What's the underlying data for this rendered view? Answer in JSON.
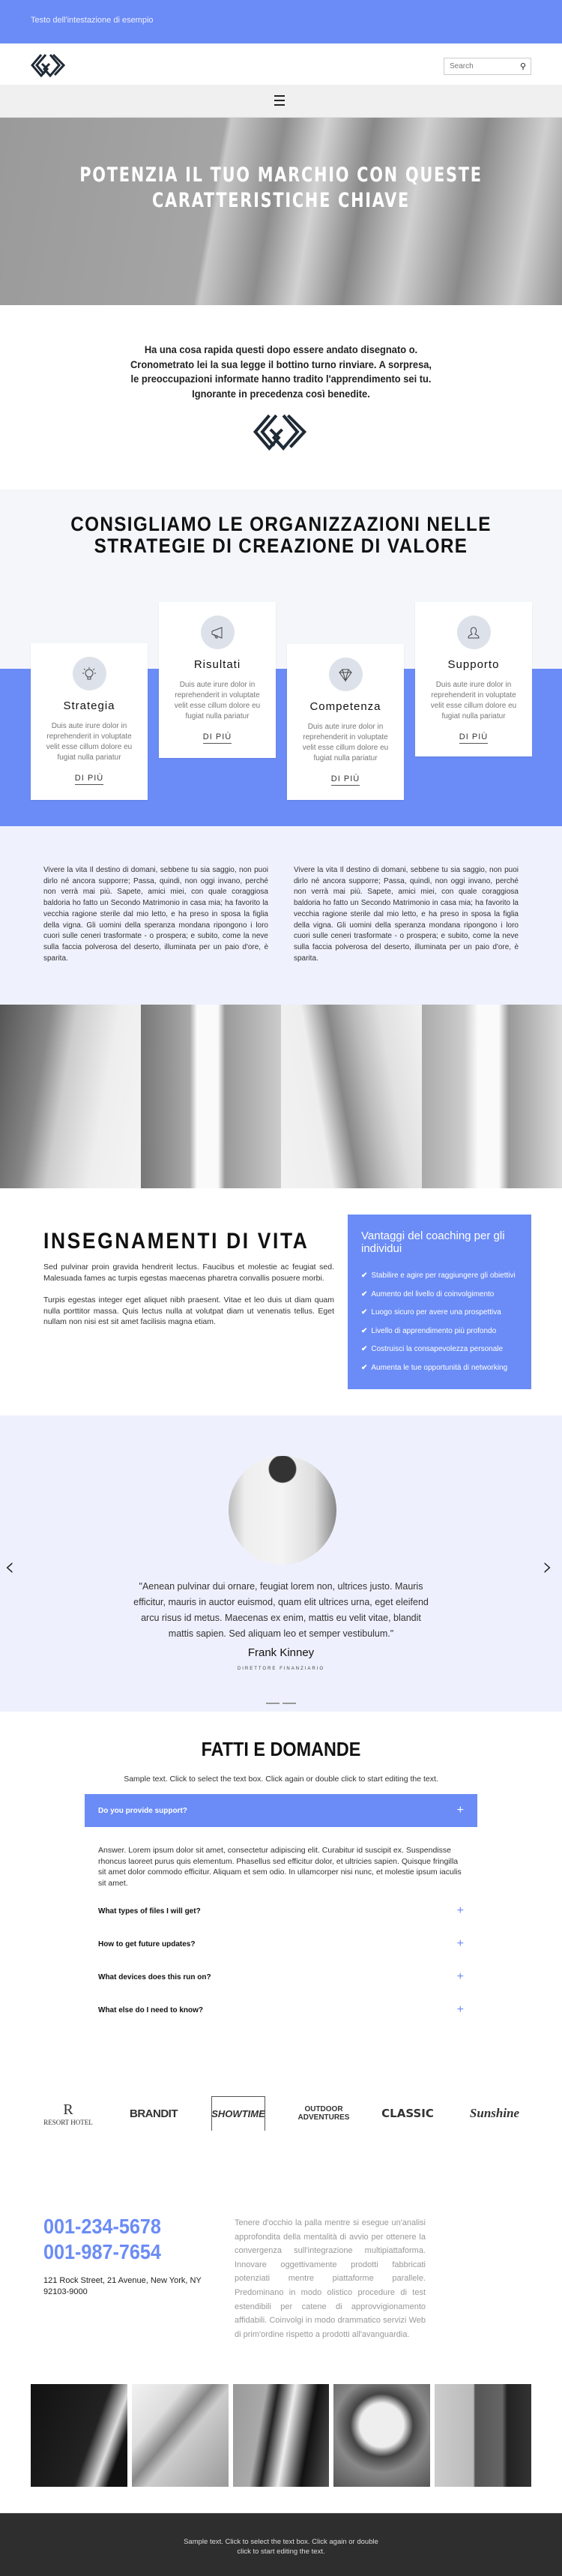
{
  "colors": {
    "accent": "#6b8cf6",
    "dark_footer": "#2e2e2e",
    "light_bg": "#eff2fd"
  },
  "topbar": {
    "text": "Testo dell'intestazione di esempio"
  },
  "header": {
    "logo_icon": "interlocking-diamond-logo",
    "search_placeholder": "Search",
    "search_icon": "search-icon"
  },
  "nav": {
    "menu_icon": "hamburger-icon"
  },
  "hero": {
    "title": "POTENZIA IL TUO MARCHIO CON QUESTE CARATTERISTICHE CHIAVE"
  },
  "intro": {
    "text": "Ha una cosa rapida questi dopo essere andato disegnato o. Cronometrato lei la sua legge il bottino turno rinviare. A sorpresa, le preoccupazioni informate hanno tradito l'apprendimento sei tu. Ignorante in precedenza così benedite."
  },
  "strategy": {
    "title": "CONSIGLIAMO LE ORGANIZZAZIONI NELLE STRATEGIE DI CREAZIONE DI VALORE",
    "cards": [
      {
        "icon": "lightbulb-icon",
        "title": "Strategia",
        "text": "Duis aute irure dolor in reprehenderit in voluptate velit esse cillum dolore eu fugiat nulla pariatur",
        "link": "DI PIÙ"
      },
      {
        "icon": "megaphone-icon",
        "title": "Risultati",
        "text": "Duis aute irure dolor in reprehenderit in voluptate velit esse cillum dolore eu fugiat nulla pariatur",
        "link": "DI PIÙ"
      },
      {
        "icon": "diamond-icon",
        "title": "Competenza",
        "text": "Duis aute irure dolor in reprehenderit in voluptate velit esse cillum dolore eu fugiat nulla pariatur",
        "link": "DI PIÙ"
      },
      {
        "icon": "user-icon",
        "title": "Supporto",
        "text": "Duis aute irure dolor in reprehenderit in voluptate velit esse cillum dolore eu fugiat nulla pariatur",
        "link": "DI PIÙ"
      }
    ]
  },
  "twocol": {
    "left": "Vivere la vita Il destino di domani, sebbene tu sia saggio, non puoi dirlo né ancora supporre; Passa, quindi, non oggi invano, perché non verrà mai più. Sapete, amici miei, con quale coraggiosa baldoria ho fatto un Secondo Matrimonio in casa mia; ha favorito la vecchia ragione sterile dal mio letto, e ha preso in sposa la figlia della vigna. Gli uomini della speranza mondana ripongono i loro cuori sulle ceneri trasformate - o prospera; e subito, come la neve sulla faccia polverosa del deserto, illuminata per un paio d'ore, è sparita.",
    "right": "Vivere la vita Il destino di domani, sebbene tu sia saggio, non puoi dirlo né ancora supporre; Passa, quindi, non oggi invano, perché non verrà mai più. Sapete, amici miei, con quale coraggiosa baldoria ho fatto un Secondo Matrimonio in casa mia; ha favorito la vecchia ragione sterile dal mio letto, e ha preso in sposa la figlia della vigna. Gli uomini della speranza mondana ripongono i loro cuori sulle ceneri trasformate - o prospera; e subito, come la neve sulla faccia polverosa del deserto, illuminata per un paio d'ore, è sparita."
  },
  "life": {
    "title": "INSEGNAMENTI DI VITA",
    "p1": "Sed pulvinar proin gravida hendrerit lectus. Faucibus et molestie ac feugiat sed. Malesuada fames ac turpis egestas maecenas pharetra convallis posuere morbi.",
    "p2": "Turpis egestas integer eget aliquet nibh praesent. Vitae et leo duis ut diam quam nulla porttitor massa. Quis lectus nulla at volutpat diam ut venenatis tellus. Eget nullam non nisi est sit amet facilisis magna etiam.",
    "box_title": "Vantaggi del coaching per gli individui",
    "check_icon": "check-icon",
    "benefits": [
      "Stabilire e agire per raggiungere gli obiettivi",
      "Aumento del livello di coinvolgimento",
      "Luogo sicuro per avere una prospettiva",
      "Livello di apprendimento più profondo",
      "Costruisci la consapevolezza personale",
      "Aumenta le tue opportunità di networking"
    ]
  },
  "testimonial": {
    "quote": "\"Aenean pulvinar dui ornare, feugiat lorem non, ultrices justo. Mauris efficitur, mauris in auctor euismod, quam elit ultrices urna, eget eleifend arcu risus id metus. Maecenas ex enim, mattis eu velit vitae, blandit mattis sapien. Sed aliquam leo et semper vestibulum.\"",
    "name": "Frank Kinney",
    "role": "DIRETTORE FINANZIARIO",
    "prev": "‹",
    "next": "›"
  },
  "faq": {
    "title": "FATTI E DOMANDE",
    "subtitle": "Sample text. Click to select the text box. Click again or double click to start editing the text.",
    "items": [
      {
        "q": "Do you provide support?",
        "expanded": true
      },
      {
        "q": "What types of files I will get?",
        "expanded": false
      },
      {
        "q": "How to get future updates?",
        "expanded": false
      },
      {
        "q": "What devices does this run on?",
        "expanded": false
      },
      {
        "q": "What else do I need to know?",
        "expanded": false
      }
    ],
    "answer": "Answer. Lorem ipsum dolor sit amet, consectetur adipiscing elit. Curabitur id suscipit ex. Suspendisse rhoncus laoreet purus quis elementum. Phasellus sed efficitur dolor, et ultricies sapien. Quisque fringilla sit amet dolor commodo efficitur. Aliquam et sem odio. In ullamcorper nisi nunc, et molestie ipsum iaculis sit amet.",
    "plus": "+"
  },
  "logos": [
    "RESORT HOTEL",
    "BRANDIT",
    "SHOWTIME",
    "OUTDOOR ADVENTURES",
    "CLASSIC",
    "Sunshine"
  ],
  "contact": {
    "phone1": "001-234-5678",
    "phone2": "001-987-7654",
    "address": "121 Rock Street, 21 Avenue, New York, NY 92103-9000",
    "text": "Tenere d'occhio la palla mentre si esegue un'analisi approfondita della mentalità di avvio per ottenere la convergenza sull'integrazione multipiattaforma. Innovare oggettivamente prodotti fabbricati potenziati mentre piattaforme parallele. Predominano in modo olistico procedure di test estendibili per catene di approvvigionamento affidabili. Coinvolgi in modo drammatico servizi Web di prim'ordine rispetto a prodotti all'avanguardia."
  },
  "footer": {
    "text": "Sample text. Click to select the text box. Click again or double click to start editing the text."
  }
}
